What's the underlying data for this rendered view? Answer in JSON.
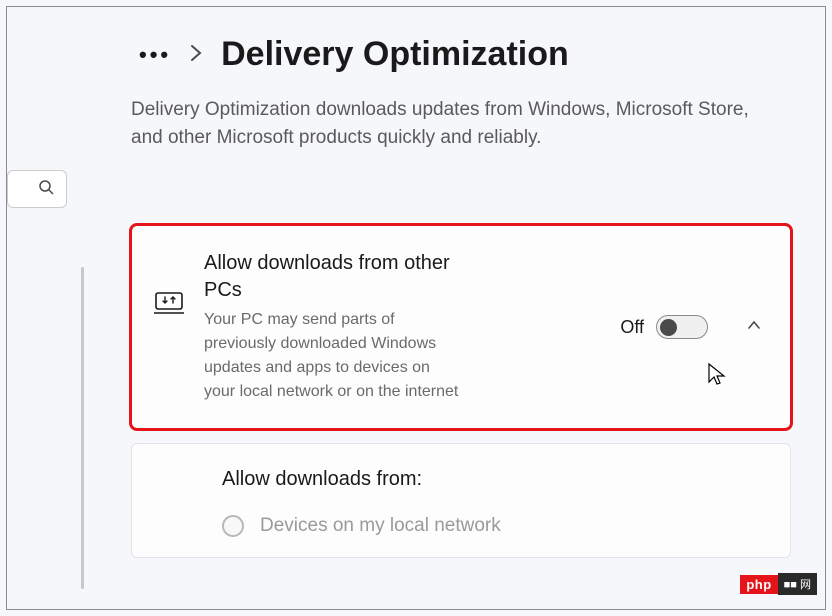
{
  "breadcrumb": {
    "dots": "…",
    "title": "Delivery Optimization"
  },
  "description": "Delivery Optimization downloads updates from Windows, Microsoft Store, and other Microsoft products quickly and reliably.",
  "search": {
    "placeholder": ""
  },
  "setting": {
    "title": "Allow downloads from other PCs",
    "desc": "Your PC may send parts of previously downloaded Windows updates and apps to devices on your local network or on the internet",
    "toggle_state": "Off"
  },
  "sub": {
    "title": "Allow downloads from:",
    "option1": "Devices on my local network"
  },
  "watermark": {
    "left": "php",
    "right": "■■ 网"
  }
}
